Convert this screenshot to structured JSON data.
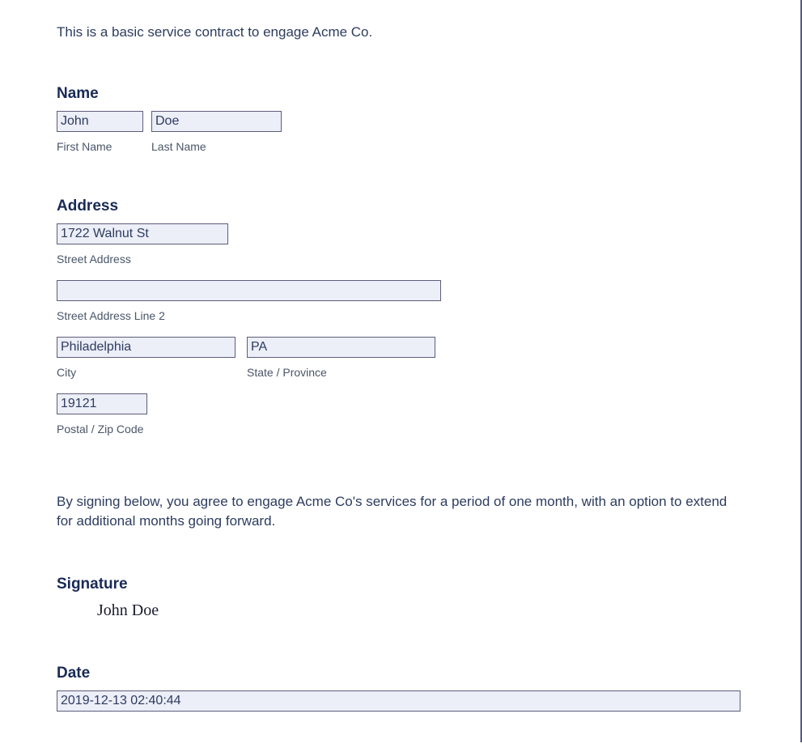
{
  "intro": "This is a basic service contract to engage Acme Co.",
  "name": {
    "heading": "Name",
    "firstName": {
      "value": "John",
      "label": "First Name"
    },
    "lastName": {
      "value": "Doe",
      "label": "Last Name"
    }
  },
  "address": {
    "heading": "Address",
    "street": {
      "value": "1722 Walnut St",
      "label": "Street Address"
    },
    "street2": {
      "value": "",
      "label": "Street Address Line 2"
    },
    "city": {
      "value": "Philadelphia",
      "label": "City"
    },
    "state": {
      "value": "PA",
      "label": "State / Province"
    },
    "zip": {
      "value": "19121",
      "label": "Postal / Zip Code"
    }
  },
  "agreement": "By signing below, you agree to engage Acme Co's services for a period of one month, with an option to extend for additional months going forward.",
  "signature": {
    "heading": "Signature",
    "value": "John Doe"
  },
  "date": {
    "heading": "Date",
    "value": "2019-12-13 02:40:44"
  }
}
